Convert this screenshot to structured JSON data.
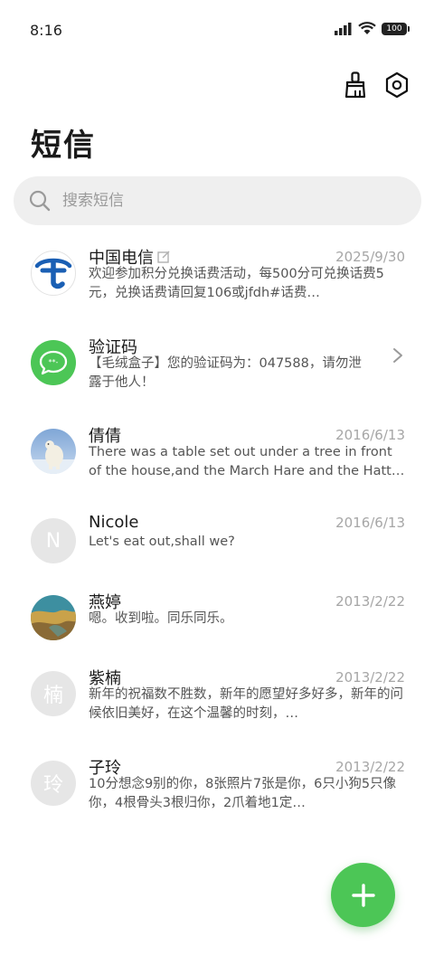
{
  "status_bar": {
    "time": "8:16",
    "battery": "100"
  },
  "header": {
    "title": "短信"
  },
  "search": {
    "placeholder": "搜索短信"
  },
  "conversations": [
    {
      "name": "中国电信",
      "date": "2025/9/30",
      "preview": "欢迎参加积分兑换话费活动，每500分可兑换话费5元，兑换话费请回复106或jfdh#话费…",
      "avatar": "telecom-logo",
      "has_edit_icon": true
    },
    {
      "name": "验证码",
      "date": "",
      "preview": "【毛绒盒子】您的验证码为：047588，请勿泄露于他人！",
      "avatar": "message-icon",
      "has_chevron": true
    },
    {
      "name": "倩倩",
      "date": "2016/6/13",
      "preview": "There was a table set out under a tree in front of the house,and the March Hare and the Hatter we…",
      "avatar": "polar-bear-photo"
    },
    {
      "name": "Nicole",
      "date": "2016/6/13",
      "preview": "Let's eat out,shall we?",
      "avatar_letter": "N"
    },
    {
      "name": "燕婷",
      "date": "2013/2/22",
      "preview": "嗯。收到啦。同乐同乐。",
      "avatar": "landscape-photo"
    },
    {
      "name": "紫楠",
      "date": "2013/2/22",
      "preview": "新年的祝福数不胜数，新年的愿望好多好多，新年的问候依旧美好，在这个温馨的时刻，…",
      "avatar_letter": "楠"
    },
    {
      "name": "子玲",
      "date": "2013/2/22",
      "preview": "10分想念9别的你，8张照片7张是你，6只小狗5只像你，4根骨头3根归你，2爪着地1定…",
      "avatar_letter": "玲"
    }
  ],
  "colors": {
    "accent": "#4cc656",
    "telecom_blue": "#1a5fb4"
  }
}
